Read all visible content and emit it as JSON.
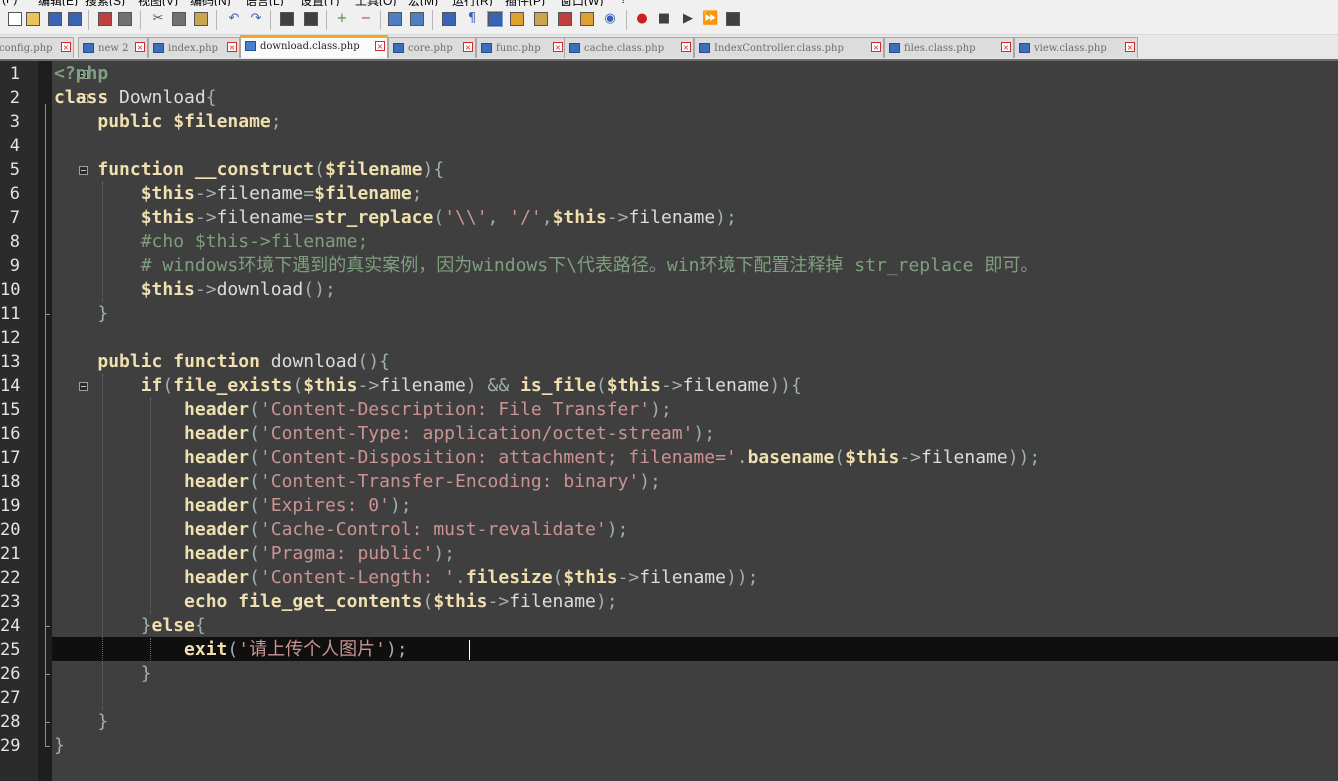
{
  "menu": {
    "items": [
      "(F)",
      "编辑(E)",
      "搜索(S)",
      "视图(V)",
      "编码(N)",
      "语言(L)",
      "设置(T)",
      "工具(O)",
      "宏(M)",
      "运行(R)",
      "插件(P)",
      "窗口(W)",
      "?"
    ]
  },
  "toolbar": {
    "icons": [
      "new-file-icon",
      "open-file-icon",
      "save-icon",
      "save-all-icon",
      "close-icon",
      "close-all-icon",
      "print-icon",
      "cut-icon",
      "copy-icon",
      "paste-icon",
      "undo-icon",
      "redo-icon",
      "find-icon",
      "replace-icon",
      "zoom-in-icon",
      "zoom-out-icon",
      "sync-vertical-icon",
      "sync-horizontal-icon",
      "word-wrap-icon",
      "show-all-chars-icon",
      "indent-guide-icon",
      "user-lang-icon",
      "doc-map-icon",
      "function-list-icon",
      "folder-workspace-icon",
      "monitor-icon",
      "record-macro-icon",
      "stop-record-icon",
      "play-macro-icon",
      "run-macro-multiple-icon",
      "save-macro-icon"
    ],
    "active_index": 20
  },
  "tabs": [
    {
      "label": "config.php",
      "active": false
    },
    {
      "label": "new 2",
      "active": false
    },
    {
      "label": "index.php",
      "active": false
    },
    {
      "label": "download.class.php",
      "active": true
    },
    {
      "label": "core.php",
      "active": false
    },
    {
      "label": "func.php",
      "active": false
    },
    {
      "label": "cache.class.php",
      "active": false
    },
    {
      "label": "IndexController.class.php",
      "active": false
    },
    {
      "label": "files.class.php",
      "active": false
    },
    {
      "label": "view.class.php",
      "active": false
    }
  ],
  "editor": {
    "current_line": 25,
    "lines": [
      [
        [
          "tag",
          "<?php"
        ]
      ],
      [
        [
          "kw",
          "class"
        ],
        [
          "plain",
          " Download"
        ],
        [
          "op",
          "{"
        ]
      ],
      [
        [
          "plain",
          "    "
        ],
        [
          "kw",
          "public"
        ],
        [
          "plain",
          " "
        ],
        [
          "vr",
          "$filename"
        ],
        [
          "op",
          ";"
        ]
      ],
      [],
      [
        [
          "plain",
          "    "
        ],
        [
          "kw",
          "function"
        ],
        [
          "plain",
          " "
        ],
        [
          "fnd",
          "__construct"
        ],
        [
          "op",
          "("
        ],
        [
          "vr",
          "$filename"
        ],
        [
          "op",
          "){"
        ]
      ],
      [
        [
          "plain",
          "        "
        ],
        [
          "vr",
          "$this"
        ],
        [
          "op",
          "->"
        ],
        [
          "plain",
          "filename"
        ],
        [
          "op",
          "="
        ],
        [
          "vr",
          "$filename"
        ],
        [
          "op",
          ";"
        ]
      ],
      [
        [
          "plain",
          "        "
        ],
        [
          "vr",
          "$this"
        ],
        [
          "op",
          "->"
        ],
        [
          "plain",
          "filename"
        ],
        [
          "op",
          "="
        ],
        [
          "fn",
          "str_replace"
        ],
        [
          "op",
          "("
        ],
        [
          "str",
          "'\\\\'"
        ],
        [
          "op",
          ", "
        ],
        [
          "str",
          "'/'"
        ],
        [
          "op",
          ","
        ],
        [
          "vr",
          "$this"
        ],
        [
          "op",
          "->"
        ],
        [
          "plain",
          "filename"
        ],
        [
          "op",
          ");"
        ]
      ],
      [
        [
          "plain",
          "        "
        ],
        [
          "cmt",
          "#cho $this->filename;"
        ]
      ],
      [
        [
          "plain",
          "        "
        ],
        [
          "cmt",
          "# windows环境下遇到的真实案例，因为windows下\\代表路径。win环境下配置注释掉 str_replace 即可。"
        ]
      ],
      [
        [
          "plain",
          "        "
        ],
        [
          "vr",
          "$this"
        ],
        [
          "op",
          "->"
        ],
        [
          "plain",
          "download"
        ],
        [
          "op",
          "();"
        ]
      ],
      [
        [
          "plain",
          "    "
        ],
        [
          "op",
          "}"
        ]
      ],
      [],
      [
        [
          "plain",
          "    "
        ],
        [
          "kw",
          "public"
        ],
        [
          "plain",
          " "
        ],
        [
          "kw",
          "function"
        ],
        [
          "plain",
          " download"
        ],
        [
          "op",
          "(){"
        ]
      ],
      [
        [
          "plain",
          "        "
        ],
        [
          "kw",
          "if"
        ],
        [
          "op",
          "("
        ],
        [
          "fn",
          "file_exists"
        ],
        [
          "op",
          "("
        ],
        [
          "vr",
          "$this"
        ],
        [
          "op",
          "->"
        ],
        [
          "plain",
          "filename"
        ],
        [
          "op",
          ") && "
        ],
        [
          "fn",
          "is_file"
        ],
        [
          "op",
          "("
        ],
        [
          "vr",
          "$this"
        ],
        [
          "op",
          "->"
        ],
        [
          "plain",
          "filename"
        ],
        [
          "op",
          ")){"
        ]
      ],
      [
        [
          "plain",
          "            "
        ],
        [
          "fn",
          "header"
        ],
        [
          "op",
          "("
        ],
        [
          "str",
          "'Content-Description: File Transfer'"
        ],
        [
          "op",
          ");"
        ]
      ],
      [
        [
          "plain",
          "            "
        ],
        [
          "fn",
          "header"
        ],
        [
          "op",
          "("
        ],
        [
          "str",
          "'Content-Type: application/octet-stream'"
        ],
        [
          "op",
          ");"
        ]
      ],
      [
        [
          "plain",
          "            "
        ],
        [
          "fn",
          "header"
        ],
        [
          "op",
          "("
        ],
        [
          "str",
          "'Content-Disposition: attachment; filename='"
        ],
        [
          "op",
          "."
        ],
        [
          "fn",
          "basename"
        ],
        [
          "op",
          "("
        ],
        [
          "vr",
          "$this"
        ],
        [
          "op",
          "->"
        ],
        [
          "plain",
          "filename"
        ],
        [
          "op",
          "));"
        ]
      ],
      [
        [
          "plain",
          "            "
        ],
        [
          "fn",
          "header"
        ],
        [
          "op",
          "("
        ],
        [
          "str",
          "'Content-Transfer-Encoding: binary'"
        ],
        [
          "op",
          ");"
        ]
      ],
      [
        [
          "plain",
          "            "
        ],
        [
          "fn",
          "header"
        ],
        [
          "op",
          "("
        ],
        [
          "str",
          "'Expires: 0'"
        ],
        [
          "op",
          ");"
        ]
      ],
      [
        [
          "plain",
          "            "
        ],
        [
          "fn",
          "header"
        ],
        [
          "op",
          "("
        ],
        [
          "str",
          "'Cache-Control: must-revalidate'"
        ],
        [
          "op",
          ");"
        ]
      ],
      [
        [
          "plain",
          "            "
        ],
        [
          "fn",
          "header"
        ],
        [
          "op",
          "("
        ],
        [
          "str",
          "'Pragma: public'"
        ],
        [
          "op",
          ");"
        ]
      ],
      [
        [
          "plain",
          "            "
        ],
        [
          "fn",
          "header"
        ],
        [
          "op",
          "("
        ],
        [
          "str",
          "'Content-Length: '"
        ],
        [
          "op",
          "."
        ],
        [
          "fn",
          "filesize"
        ],
        [
          "op",
          "("
        ],
        [
          "vr",
          "$this"
        ],
        [
          "op",
          "->"
        ],
        [
          "plain",
          "filename"
        ],
        [
          "op",
          "));"
        ]
      ],
      [
        [
          "plain",
          "            "
        ],
        [
          "kw",
          "echo"
        ],
        [
          "plain",
          " "
        ],
        [
          "fn",
          "file_get_contents"
        ],
        [
          "op",
          "("
        ],
        [
          "vr",
          "$this"
        ],
        [
          "op",
          "->"
        ],
        [
          "plain",
          "filename"
        ],
        [
          "op",
          ");"
        ]
      ],
      [
        [
          "plain",
          "        "
        ],
        [
          "op",
          "}"
        ],
        [
          "kw",
          "else"
        ],
        [
          "op",
          "{"
        ]
      ],
      [
        [
          "plain",
          "            "
        ],
        [
          "kw",
          "exit"
        ],
        [
          "op",
          "("
        ],
        [
          "str",
          "'请上传个人图片'"
        ],
        [
          "op",
          ");"
        ]
      ],
      [
        [
          "plain",
          "        "
        ],
        [
          "op",
          "}"
        ]
      ],
      [],
      [
        [
          "plain",
          "    "
        ],
        [
          "op",
          "}"
        ]
      ],
      [
        [
          "op",
          "}"
        ]
      ]
    ]
  }
}
